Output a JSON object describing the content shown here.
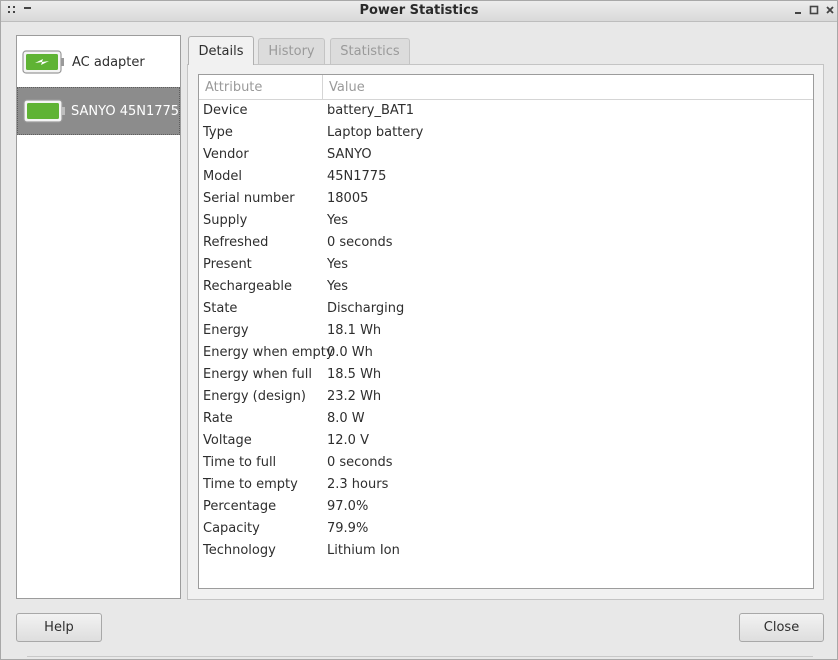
{
  "window": {
    "title": "Power Statistics"
  },
  "devices": [
    {
      "label": "AC adapter",
      "icon": "ac-adapter-icon",
      "selected": false
    },
    {
      "label": "SANYO 45N1775",
      "icon": "battery-icon",
      "selected": true
    }
  ],
  "tabs": [
    {
      "label": "Details",
      "active": true
    },
    {
      "label": "History",
      "active": false
    },
    {
      "label": "Statistics",
      "active": false
    }
  ],
  "table": {
    "headers": {
      "attribute": "Attribute",
      "value": "Value"
    },
    "rows": [
      {
        "attribute": "Device",
        "value": "battery_BAT1"
      },
      {
        "attribute": "Type",
        "value": "Laptop battery"
      },
      {
        "attribute": "Vendor",
        "value": "SANYO"
      },
      {
        "attribute": "Model",
        "value": "45N1775"
      },
      {
        "attribute": "Serial number",
        "value": "18005"
      },
      {
        "attribute": "Supply",
        "value": "Yes"
      },
      {
        "attribute": "Refreshed",
        "value": "0 seconds"
      },
      {
        "attribute": "Present",
        "value": "Yes"
      },
      {
        "attribute": "Rechargeable",
        "value": "Yes"
      },
      {
        "attribute": "State",
        "value": "Discharging"
      },
      {
        "attribute": "Energy",
        "value": "18.1 Wh"
      },
      {
        "attribute": "Energy when empty",
        "value": "0.0 Wh"
      },
      {
        "attribute": "Energy when full",
        "value": "18.5 Wh"
      },
      {
        "attribute": "Energy (design)",
        "value": "23.2 Wh"
      },
      {
        "attribute": "Rate",
        "value": "8.0 W"
      },
      {
        "attribute": "Voltage",
        "value": "12.0 V"
      },
      {
        "attribute": "Time to full",
        "value": "0 seconds"
      },
      {
        "attribute": "Time to empty",
        "value": "2.3 hours"
      },
      {
        "attribute": "Percentage",
        "value": "97.0%"
      },
      {
        "attribute": "Capacity",
        "value": "79.9%"
      },
      {
        "attribute": "Technology",
        "value": "Lithium Ion"
      }
    ]
  },
  "buttons": {
    "help": "Help",
    "close": "Close"
  },
  "colors": {
    "battery_green": "#5fb334",
    "selection_bg": "#8c8c8c"
  }
}
